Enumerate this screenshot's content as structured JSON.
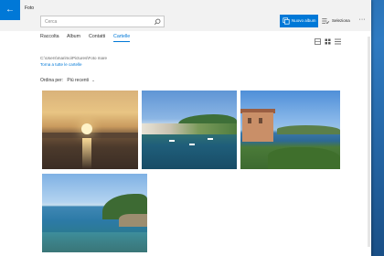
{
  "window": {
    "app_title": "Foto"
  },
  "search": {
    "placeholder": "Cerca"
  },
  "toolbar": {
    "new_album_label": "Nuovo album",
    "select_label": "Seleziona",
    "more_label": "···"
  },
  "tabs": [
    {
      "label": "Raccolta"
    },
    {
      "label": "Album"
    },
    {
      "label": "Contatti"
    },
    {
      "label": "Cartelle",
      "active": true
    }
  ],
  "folder": {
    "path": "C:\\Users\\marimo\\Pictures\\Foto mare",
    "back_link": "Torna a tutte le cartelle"
  },
  "sort": {
    "label": "Ordina per:",
    "value": "Più recenti"
  },
  "icons": {
    "back": "back-arrow-icon",
    "search": "search-icon",
    "new_album": "album-icon",
    "select": "select-icon",
    "view_grid": "grid-view-icon",
    "view_list": "list-view-icon",
    "view_details": "details-view-icon"
  },
  "colors": {
    "accent": "#0078d7",
    "titlebar": "#f2f2f2"
  },
  "photos": [
    {
      "subject": "sunset-sea"
    },
    {
      "subject": "harbor-town"
    },
    {
      "subject": "coastal-house"
    },
    {
      "subject": "rocky-cape"
    }
  ]
}
